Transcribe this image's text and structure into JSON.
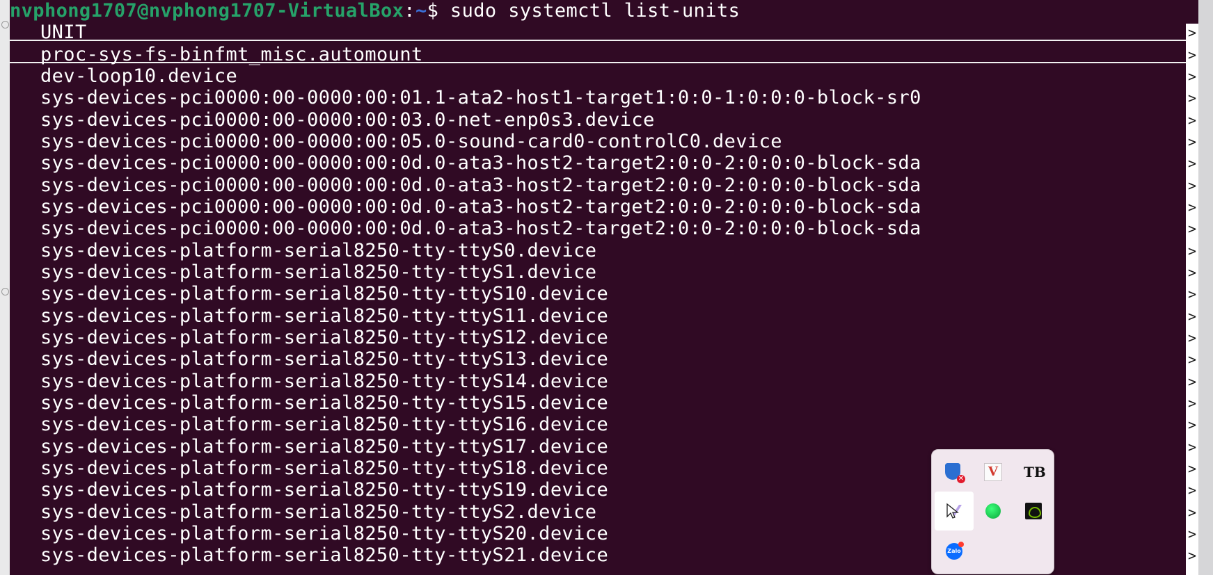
{
  "terminal": {
    "prompt": {
      "user_host": "nvphong1707@nvphong1707-VirtualBox",
      "separator": ":",
      "path": "~",
      "symbol": "$",
      "command": "sudo systemctl list-units"
    },
    "header": "UNIT",
    "rows": [
      "proc-sys-fs-binfmt_misc.automount",
      "dev-loop10.device",
      "sys-devices-pci0000:00-0000:00:01.1-ata2-host1-target1:0:0-1:0:0:0-block-sr0",
      "sys-devices-pci0000:00-0000:00:03.0-net-enp0s3.device",
      "sys-devices-pci0000:00-0000:00:05.0-sound-card0-controlC0.device",
      "sys-devices-pci0000:00-0000:00:0d.0-ata3-host2-target2:0:0-2:0:0:0-block-sda",
      "sys-devices-pci0000:00-0000:00:0d.0-ata3-host2-target2:0:0-2:0:0:0-block-sda",
      "sys-devices-pci0000:00-0000:00:0d.0-ata3-host2-target2:0:0-2:0:0:0-block-sda",
      "sys-devices-pci0000:00-0000:00:0d.0-ata3-host2-target2:0:0-2:0:0:0-block-sda",
      "sys-devices-platform-serial8250-tty-ttyS0.device",
      "sys-devices-platform-serial8250-tty-ttyS1.device",
      "sys-devices-platform-serial8250-tty-ttyS10.device",
      "sys-devices-platform-serial8250-tty-ttyS11.device",
      "sys-devices-platform-serial8250-tty-ttyS12.device",
      "sys-devices-platform-serial8250-tty-ttyS13.device",
      "sys-devices-platform-serial8250-tty-ttyS14.device",
      "sys-devices-platform-serial8250-tty-ttyS15.device",
      "sys-devices-platform-serial8250-tty-ttyS16.device",
      "sys-devices-platform-serial8250-tty-ttyS17.device",
      "sys-devices-platform-serial8250-tty-ttyS18.device",
      "sys-devices-platform-serial8250-tty-ttyS19.device",
      "sys-devices-platform-serial8250-tty-ttyS2.device",
      "sys-devices-platform-serial8250-tty-ttyS20.device",
      "sys-devices-platform-serial8250-tty-ttyS21.device"
    ],
    "overflow_marker": ">",
    "colors": {
      "background": "#300a24",
      "text": "#ffffff",
      "prompt_user": "#26a269",
      "prompt_path": "#3a6fd6"
    }
  },
  "tray": {
    "icons": [
      {
        "name": "windows-security-shield-icon",
        "glyph": "✕"
      },
      {
        "name": "v-app-icon",
        "glyph": "V"
      },
      {
        "name": "tb-app-icon",
        "glyph": "TB"
      },
      {
        "name": "pen-cursor-app-icon",
        "glyph": ""
      },
      {
        "name": "green-status-icon",
        "glyph": ""
      },
      {
        "name": "nvidia-icon",
        "glyph": ""
      },
      {
        "name": "zalo-icon",
        "glyph": "Zalo"
      }
    ]
  }
}
